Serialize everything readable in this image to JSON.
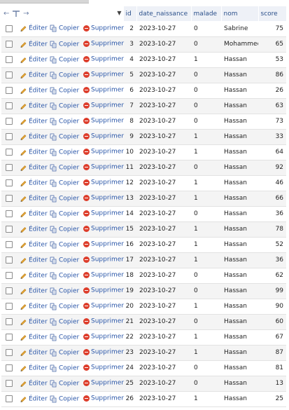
{
  "header": {
    "controls": {
      "left_arrow": "←",
      "right_arrow": "→",
      "sort_glyph": "▼"
    },
    "columns": [
      "id",
      "date_naissance",
      "malade",
      "nom",
      "score"
    ]
  },
  "actions": {
    "edit": "Éditer",
    "copy": "Copier",
    "delete": "Supprimer"
  },
  "rows": [
    {
      "id": "2",
      "date_naissance": "2023-10-27",
      "malade": "0",
      "nom": "Sabrine",
      "score": "75"
    },
    {
      "id": "3",
      "date_naissance": "2023-10-27",
      "malade": "0",
      "nom": "Mohammed",
      "score": "65"
    },
    {
      "id": "4",
      "date_naissance": "2023-10-27",
      "malade": "1",
      "nom": "Hassan",
      "score": "53"
    },
    {
      "id": "5",
      "date_naissance": "2023-10-27",
      "malade": "0",
      "nom": "Hassan",
      "score": "86"
    },
    {
      "id": "6",
      "date_naissance": "2023-10-27",
      "malade": "0",
      "nom": "Hassan",
      "score": "26"
    },
    {
      "id": "7",
      "date_naissance": "2023-10-27",
      "malade": "0",
      "nom": "Hassan",
      "score": "63"
    },
    {
      "id": "8",
      "date_naissance": "2023-10-27",
      "malade": "0",
      "nom": "Hassan",
      "score": "73"
    },
    {
      "id": "9",
      "date_naissance": "2023-10-27",
      "malade": "1",
      "nom": "Hassan",
      "score": "33"
    },
    {
      "id": "10",
      "date_naissance": "2023-10-27",
      "malade": "1",
      "nom": "Hassan",
      "score": "64"
    },
    {
      "id": "11",
      "date_naissance": "2023-10-27",
      "malade": "0",
      "nom": "Hassan",
      "score": "92"
    },
    {
      "id": "12",
      "date_naissance": "2023-10-27",
      "malade": "1",
      "nom": "Hassan",
      "score": "46"
    },
    {
      "id": "13",
      "date_naissance": "2023-10-27",
      "malade": "1",
      "nom": "Hassan",
      "score": "66"
    },
    {
      "id": "14",
      "date_naissance": "2023-10-27",
      "malade": "0",
      "nom": "Hassan",
      "score": "36"
    },
    {
      "id": "15",
      "date_naissance": "2023-10-27",
      "malade": "1",
      "nom": "Hassan",
      "score": "78"
    },
    {
      "id": "16",
      "date_naissance": "2023-10-27",
      "malade": "1",
      "nom": "Hassan",
      "score": "52"
    },
    {
      "id": "17",
      "date_naissance": "2023-10-27",
      "malade": "1",
      "nom": "Hassan",
      "score": "36"
    },
    {
      "id": "18",
      "date_naissance": "2023-10-27",
      "malade": "0",
      "nom": "Hassan",
      "score": "62"
    },
    {
      "id": "19",
      "date_naissance": "2023-10-27",
      "malade": "0",
      "nom": "Hassan",
      "score": "99"
    },
    {
      "id": "20",
      "date_naissance": "2023-10-27",
      "malade": "1",
      "nom": "Hassan",
      "score": "90"
    },
    {
      "id": "21",
      "date_naissance": "2023-10-27",
      "malade": "0",
      "nom": "Hassan",
      "score": "60"
    },
    {
      "id": "22",
      "date_naissance": "2023-10-27",
      "malade": "1",
      "nom": "Hassan",
      "score": "67"
    },
    {
      "id": "23",
      "date_naissance": "2023-10-27",
      "malade": "1",
      "nom": "Hassan",
      "score": "87"
    },
    {
      "id": "24",
      "date_naissance": "2023-10-27",
      "malade": "0",
      "nom": "Hassan",
      "score": "81"
    },
    {
      "id": "25",
      "date_naissance": "2023-10-27",
      "malade": "0",
      "nom": "Hassan",
      "score": "13"
    },
    {
      "id": "26",
      "date_naissance": "2023-10-27",
      "malade": "1",
      "nom": "Hassan",
      "score": "25"
    }
  ],
  "colors": {
    "link": "#2a56a8",
    "header_text": "#2a4f8a",
    "delete_icon": "#dd3d2b",
    "row_alt": "#f4f4f4"
  }
}
